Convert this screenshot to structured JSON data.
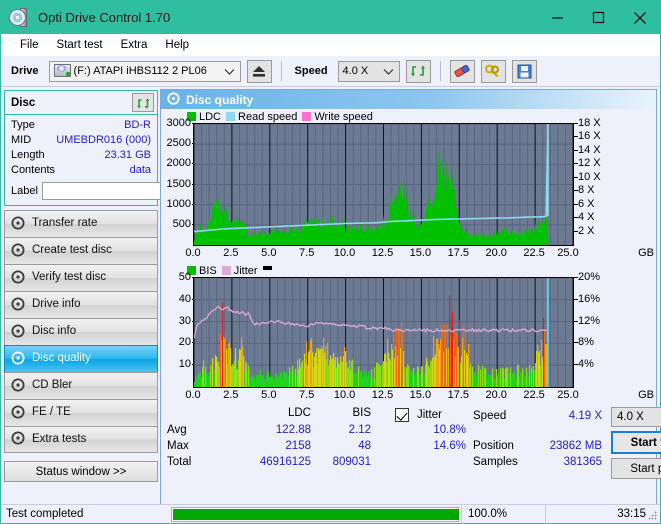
{
  "window": {
    "title": "Opti Drive Control 1.70",
    "icon": "disc-drive-icon",
    "minimize": "minimize-icon",
    "maximize": "maximize-icon",
    "close": "close-icon",
    "titlebar_color": "#2fbfa0"
  },
  "menu": {
    "items": [
      "File",
      "Start test",
      "Extra",
      "Help"
    ]
  },
  "toolbar": {
    "drive_label": "Drive",
    "drive_value": "(F:)  ATAPI iHBS112  2 PL06",
    "eject_icon": "eject-icon",
    "speed_label": "Speed",
    "speed_value": "4.0 X",
    "refresh_icon": "refresh-icon",
    "eraser_icon": "eraser-icon",
    "keys_icon": "keys-icon",
    "save_icon": "floppy-save-icon"
  },
  "disc": {
    "header": "Disc",
    "refresh_icon": "refresh-icon",
    "rows": [
      {
        "key": "Type",
        "value": "BD-R"
      },
      {
        "key": "MID",
        "value": "UMEBDR016 (000)"
      },
      {
        "key": "Length",
        "value": "23.31 GB"
      },
      {
        "key": "Contents",
        "value": "data"
      }
    ],
    "label_key": "Label",
    "label_value": "",
    "label_placeholder": "",
    "disc_icon": "cd-disc-icon"
  },
  "sidebar": {
    "items": [
      {
        "label": "Transfer rate",
        "icon": "disc-icon",
        "active": false
      },
      {
        "label": "Create test disc",
        "icon": "disc-icon",
        "active": false
      },
      {
        "label": "Verify test disc",
        "icon": "disc-icon",
        "active": false
      },
      {
        "label": "Drive info",
        "icon": "disc-icon",
        "active": false
      },
      {
        "label": "Disc info",
        "icon": "disc-icon",
        "active": false
      },
      {
        "label": "Disc quality",
        "icon": "disc-icon",
        "active": true
      },
      {
        "label": "CD Bler",
        "icon": "disc-icon",
        "active": false
      },
      {
        "label": "FE / TE",
        "icon": "disc-icon",
        "active": false
      },
      {
        "label": "Extra tests",
        "icon": "disc-icon",
        "active": false
      }
    ],
    "status_window": "Status window >>"
  },
  "panel": {
    "title": "Disc quality",
    "icon": "disc-quality-icon"
  },
  "chart_data": [
    {
      "type": "area",
      "title": "Disc quality - LDC",
      "xlabel": "GB",
      "ylabel": "LDC",
      "xlim": [
        0.0,
        25.0
      ],
      "ylim": [
        0,
        3000
      ],
      "y2lim": [
        0,
        18
      ],
      "y2label": "X",
      "grid": true,
      "legend_position": "top-left",
      "legend": [
        {
          "name": "LDC",
          "color": "#00c000"
        },
        {
          "name": "Read speed",
          "color": "#8fd8f0"
        },
        {
          "name": "Write speed",
          "color": "#ff6fd0"
        }
      ],
      "xticks": [
        "0.0",
        "2.5",
        "5.0",
        "7.5",
        "10.0",
        "12.5",
        "15.0",
        "17.5",
        "20.0",
        "22.5",
        "25.0"
      ],
      "yticks": [
        500,
        1000,
        1500,
        2000,
        2500,
        3000
      ],
      "y2ticks": [
        "2 X",
        "4 X",
        "6 X",
        "8 X",
        "10 X",
        "12 X",
        "14 X",
        "16 X",
        "18 X"
      ],
      "series": [
        {
          "name": "LDC",
          "color": "#00c000",
          "x": [
            0.0,
            0.15,
            0.3,
            0.5,
            0.7,
            0.9,
            1.1,
            1.3,
            1.5,
            1.7,
            1.8,
            1.9,
            2.0,
            2.1,
            2.2,
            2.3,
            2.4,
            2.5,
            2.7,
            2.9,
            3.0,
            3.2,
            3.4,
            3.5,
            3.6,
            3.8,
            4.0,
            4.3,
            4.6,
            5.0,
            5.4,
            5.8,
            6.2,
            6.6,
            7.0,
            7.4,
            7.8,
            8.1,
            8.4,
            8.7,
            9.0,
            9.3,
            9.6,
            9.9,
            10.2,
            10.5,
            10.9,
            11.3,
            11.7,
            12.1,
            12.5,
            12.9,
            13.2,
            13.5,
            13.8,
            14.0,
            14.3,
            14.6,
            15.0,
            15.4,
            15.8,
            16.1,
            16.4,
            16.7,
            16.9,
            17.1,
            17.3,
            17.5,
            17.7,
            17.9,
            18.2,
            18.6,
            19.0,
            19.5,
            20.0,
            20.5,
            21.0,
            21.5,
            22.0,
            22.4,
            22.7,
            22.9,
            23.1,
            23.3,
            23.35,
            23.4
          ],
          "values": [
            180,
            300,
            420,
            520,
            480,
            560,
            700,
            980,
            1300,
            1450,
            1200,
            980,
            1150,
            1300,
            900,
            700,
            620,
            560,
            700,
            520,
            760,
            600,
            560,
            420,
            280,
            240,
            300,
            340,
            320,
            360,
            400,
            380,
            420,
            440,
            480,
            560,
            620,
            700,
            600,
            560,
            640,
            680,
            560,
            520,
            560,
            520,
            480,
            460,
            440,
            520,
            600,
            900,
            1300,
            1560,
            1480,
            1200,
            820,
            680,
            700,
            900,
            1400,
            1800,
            2150,
            1900,
            1700,
            1500,
            1100,
            700,
            520,
            380,
            320,
            300,
            280,
            260,
            280,
            420,
            360,
            300,
            340,
            420,
            600,
            520,
            760,
            980,
            700,
            40
          ]
        },
        {
          "name": "Read speed",
          "color": "#8fd8f0",
          "x": [
            0.0,
            1.0,
            2.0,
            3.0,
            4.0,
            5.0,
            6.0,
            7.0,
            8.0,
            9.0,
            10.0,
            11.0,
            12.0,
            13.0,
            14.0,
            15.0,
            16.0,
            17.0,
            18.0,
            19.0,
            20.0,
            21.0,
            22.0,
            23.0,
            23.3,
            23.32,
            23.35
          ],
          "values": [
            2.0,
            2.2,
            2.4,
            2.5,
            2.6,
            2.7,
            2.8,
            2.9,
            3.0,
            3.1,
            3.2,
            3.25,
            3.3,
            3.5,
            3.6,
            3.7,
            3.8,
            3.85,
            3.9,
            3.95,
            4.0,
            4.05,
            4.15,
            4.2,
            4.3,
            12.0,
            18.0
          ]
        },
        {
          "name": "Write speed",
          "color": "#ff6fd0",
          "x": [],
          "values": []
        }
      ]
    },
    {
      "type": "area",
      "title": "Disc quality - BIS / Jitter",
      "xlabel": "GB",
      "ylabel": "BIS",
      "xlim": [
        0.0,
        25.0
      ],
      "ylim": [
        0,
        50
      ],
      "y2lim": [
        0,
        20
      ],
      "y2label": "%",
      "grid": true,
      "legend_position": "top-left",
      "legend": [
        {
          "name": "BIS",
          "color": "#00c000"
        },
        {
          "name": "Jitter",
          "color": "#dbaad8"
        }
      ],
      "xticks": [
        "0.0",
        "2.5",
        "5.0",
        "7.5",
        "10.0",
        "12.5",
        "15.0",
        "17.5",
        "20.0",
        "22.5",
        "25.0"
      ],
      "yticks": [
        10,
        20,
        30,
        40,
        50
      ],
      "y2ticks": [
        "4%",
        "8%",
        "12%",
        "16%",
        "20%"
      ],
      "series": [
        {
          "name": "BIS",
          "color": "gradient-green-yellow-orange-red",
          "x": [
            0.0,
            0.2,
            0.4,
            0.6,
            0.8,
            1.0,
            1.2,
            1.4,
            1.6,
            1.8,
            1.9,
            2.0,
            2.1,
            2.2,
            2.3,
            2.5,
            2.7,
            2.9,
            3.1,
            3.3,
            3.5,
            3.6,
            3.8,
            4.0,
            4.4,
            4.8,
            5.2,
            5.6,
            6.0,
            6.5,
            7.0,
            7.5,
            7.8,
            8.1,
            8.4,
            8.7,
            9.0,
            9.3,
            9.6,
            10.0,
            10.4,
            10.8,
            11.2,
            11.6,
            12.0,
            12.5,
            13.0,
            13.4,
            13.7,
            13.8,
            14.0,
            14.3,
            14.6,
            15.0,
            15.4,
            15.8,
            16.0,
            16.3,
            16.5,
            16.7,
            16.9,
            17.0,
            17.2,
            17.4,
            17.6,
            17.8,
            18.2,
            18.6,
            19.0,
            19.5,
            20.0,
            20.5,
            21.0,
            21.5,
            22.0,
            22.5,
            22.8,
            23.0,
            23.2,
            23.3,
            23.35
          ],
          "values": [
            3,
            7,
            9,
            10,
            8,
            9,
            10,
            12,
            16,
            31,
            27,
            24,
            29,
            22,
            26,
            14,
            16,
            18,
            26,
            14,
            12,
            8,
            6,
            5,
            6,
            7,
            6,
            6,
            7,
            9,
            13,
            20,
            16,
            18,
            19,
            16,
            14,
            17,
            12,
            18,
            11,
            9,
            8,
            7,
            9,
            14,
            21,
            30,
            26,
            20,
            14,
            10,
            9,
            8,
            13,
            22,
            26,
            31,
            38,
            34,
            48,
            33,
            31,
            28,
            30,
            22,
            12,
            9,
            8,
            7,
            8,
            9,
            7,
            8,
            9,
            14,
            20,
            32,
            29,
            18,
            4
          ]
        },
        {
          "name": "Jitter",
          "color": "#dbaad8",
          "x": [
            0.0,
            0.2,
            0.4,
            0.6,
            0.8,
            1.0,
            1.2,
            1.4,
            1.6,
            1.8,
            2.0,
            2.2,
            2.4,
            2.6,
            2.8,
            3.0,
            3.2,
            3.4,
            3.6,
            3.8,
            4.0,
            4.5,
            5.0,
            5.5,
            6.0,
            6.5,
            7.0,
            7.5,
            8.0,
            8.5,
            9.0,
            9.5,
            10.0,
            10.5,
            11.0,
            11.5,
            12.0,
            12.5,
            13.0,
            13.5,
            14.0,
            14.5,
            15.0,
            15.5,
            16.0,
            16.5,
            17.0,
            17.5,
            18.0,
            18.5,
            19.0,
            19.5,
            20.0,
            20.5,
            21.0,
            21.5,
            22.0,
            22.5,
            23.0,
            23.3
          ],
          "values": [
            22,
            28,
            30,
            31,
            32,
            33,
            35,
            36,
            37,
            36,
            36,
            37,
            35,
            35,
            34,
            34,
            35,
            33,
            34,
            30,
            29,
            29,
            30,
            30,
            29,
            29,
            28,
            28,
            29,
            29,
            29,
            28,
            29,
            28,
            28,
            27,
            27,
            27,
            26,
            26,
            26,
            26,
            26,
            26,
            26,
            26,
            26,
            26,
            26,
            26,
            26,
            26,
            26,
            26,
            26,
            26,
            26,
            26,
            26,
            26
          ]
        }
      ]
    }
  ],
  "stats": {
    "columns": [
      "LDC",
      "BIS"
    ],
    "rows": [
      {
        "label": "Avg",
        "ldc": "122.88",
        "bis": "2.12",
        "jitter": "10.8%"
      },
      {
        "label": "Max",
        "ldc": "2158",
        "bis": "48",
        "jitter": "14.6%"
      },
      {
        "label": "Total",
        "ldc": "46916125",
        "bis": "809031",
        "jitter": ""
      }
    ],
    "jitter_label": "Jitter",
    "jitter_checked": true,
    "speed_label": "Speed",
    "speed_value": "4.19 X",
    "position_label": "Position",
    "position_value": "23862 MB",
    "samples_label": "Samples",
    "samples_value": "381365",
    "speed_select": "4.0 X",
    "start_full": "Start full",
    "start_part": "Start part"
  },
  "statusbar": {
    "message": "Test completed",
    "progress_percent": "100.0%",
    "progress_value": 100,
    "elapsed": "33:15"
  }
}
